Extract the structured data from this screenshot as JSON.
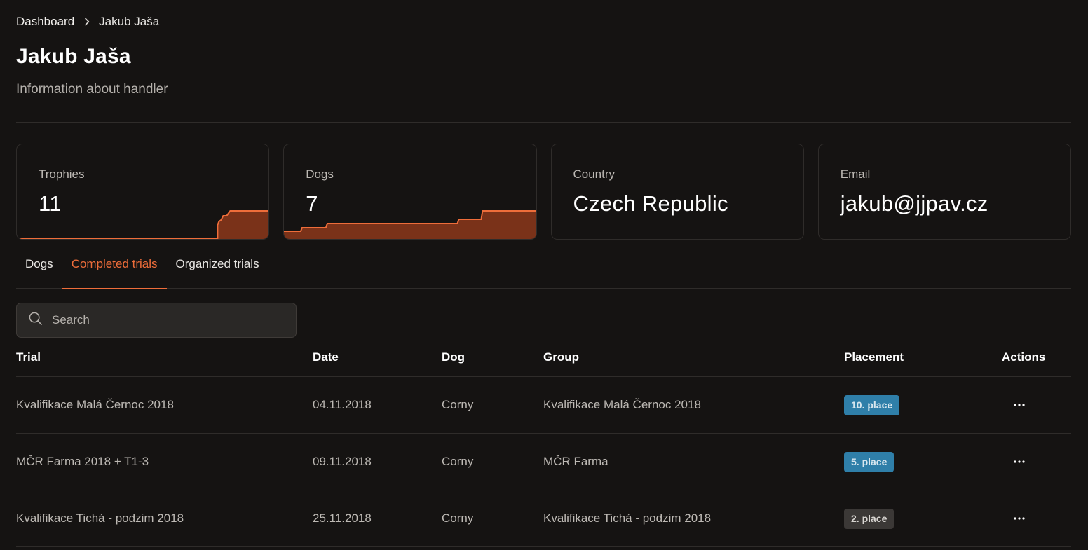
{
  "breadcrumb": {
    "home": "Dashboard",
    "current": "Jakub Jaša"
  },
  "header": {
    "title": "Jakub Jaša",
    "subtitle": "Information about handler"
  },
  "stats": [
    {
      "label": "Trophies",
      "value": "11",
      "has_chart": true
    },
    {
      "label": "Dogs",
      "value": "7",
      "has_chart": true
    },
    {
      "label": "Country",
      "value": "Czech Republic",
      "has_chart": false
    },
    {
      "label": "Email",
      "value": "jakub@jjpav.cz",
      "has_chart": false
    }
  ],
  "tabs": [
    {
      "label": "Dogs",
      "active": false
    },
    {
      "label": "Completed trials",
      "active": true
    },
    {
      "label": "Organized trials",
      "active": false
    }
  ],
  "search": {
    "placeholder": "Search",
    "value": ""
  },
  "table": {
    "columns": [
      "Trial",
      "Date",
      "Dog",
      "Group",
      "Placement",
      "Actions"
    ],
    "rows": [
      {
        "trial": "Kvalifikace Malá Černoc 2018",
        "date": "04.11.2018",
        "dog": "Corny",
        "group": "Kvalifikace Malá Černoc 2018",
        "placement": "10. place",
        "placement_color": "blue"
      },
      {
        "trial": "MČR Farma 2018 + T1-3",
        "date": "09.11.2018",
        "dog": "Corny",
        "group": "MČR Farma",
        "placement": "5. place",
        "placement_color": "blue"
      },
      {
        "trial": "Kvalifikace Tichá - podzim 2018",
        "date": "25.11.2018",
        "dog": "Corny",
        "group": "Kvalifikace Tichá - podzim 2018",
        "placement": "2. place",
        "placement_color": "grey"
      }
    ]
  },
  "colors": {
    "accent": "#ee6d3a",
    "chart_fill": "#7a3219",
    "badge_blue": "#2f7fa9",
    "badge_grey": "#3b3836",
    "background": "#151312"
  }
}
